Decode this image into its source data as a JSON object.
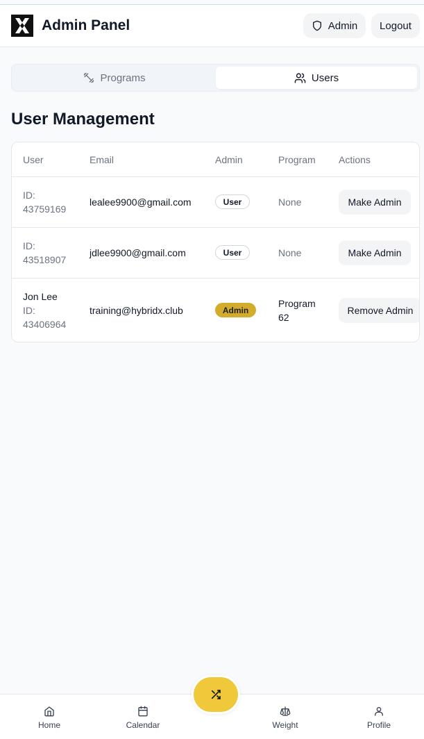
{
  "header": {
    "title": "Admin Panel",
    "admin_label": "Admin",
    "logout_label": "Logout"
  },
  "tabs": [
    {
      "label": "Programs",
      "active": false
    },
    {
      "label": "Users",
      "active": true
    }
  ],
  "page_title": "User Management",
  "table": {
    "columns": [
      "User",
      "Email",
      "Admin",
      "Program",
      "Actions"
    ],
    "rows": [
      {
        "name": "",
        "id_label": "ID:",
        "id": "43759169",
        "email": "lealee9900@gmail.com",
        "role": "User",
        "program": "None",
        "action": "Make Admin"
      },
      {
        "name": "",
        "id_label": "ID:",
        "id": "43518907",
        "email": "jdlee9900@gmail.com",
        "role": "User",
        "program": "None",
        "action": "Make Admin"
      },
      {
        "name": "Jon Lee",
        "id_label": "ID:",
        "id": "43406964",
        "email": "training@hybridx.club",
        "role": "Admin",
        "program": "Program 62",
        "action": "Remove Admin"
      }
    ]
  },
  "bottom_nav": [
    {
      "label": "Home",
      "icon": "home-icon"
    },
    {
      "label": "Calendar",
      "icon": "calendar-icon"
    },
    {
      "label": "Weight",
      "icon": "scale-icon"
    },
    {
      "label": "Profile",
      "icon": "user-icon"
    }
  ],
  "fab_icon": "shuffle-icon",
  "colors": {
    "accent": "#f0c93a",
    "admin_badge": "#d4ac2b",
    "background": "#f8fafc"
  }
}
